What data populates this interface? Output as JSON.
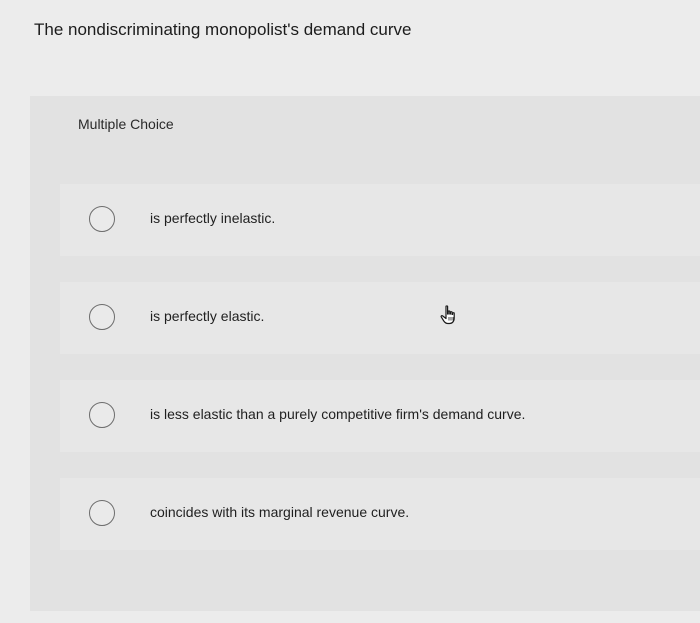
{
  "question": {
    "text": "The nondiscriminating monopolist's demand curve"
  },
  "panel": {
    "label": "Multiple Choice"
  },
  "choices": [
    {
      "text": "is perfectly inelastic."
    },
    {
      "text": "is perfectly elastic."
    },
    {
      "text": "is less elastic than a purely competitive firm's demand curve."
    },
    {
      "text": "coincides with its marginal revenue curve."
    }
  ],
  "icons": {
    "pointer": "hand-pointer-icon"
  }
}
